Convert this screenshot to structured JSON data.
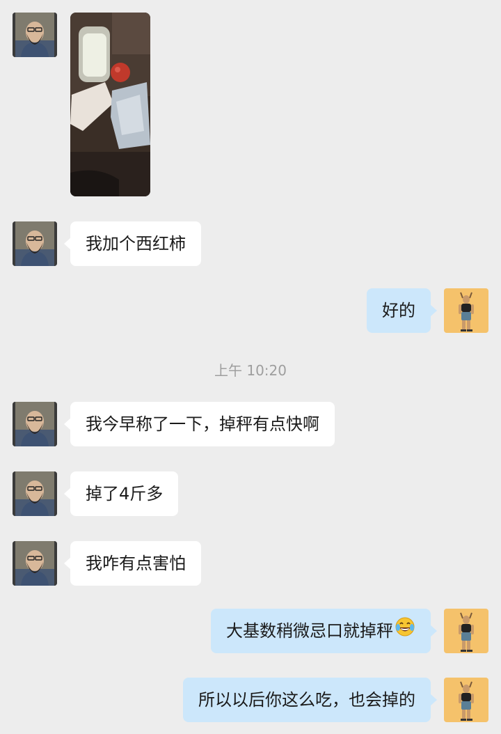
{
  "messages": [
    {
      "sender": "contact",
      "type": "image"
    },
    {
      "sender": "contact",
      "text": "我加个西红柿"
    },
    {
      "sender": "me",
      "text": "好的"
    },
    {
      "type": "timestamp",
      "text": "上午 10:20"
    },
    {
      "sender": "contact",
      "text": "我今早称了一下，掉秤有点快啊"
    },
    {
      "sender": "contact",
      "text": "掉了4斤多"
    },
    {
      "sender": "contact",
      "text": "我咋有点害怕"
    },
    {
      "sender": "me",
      "text": "大基数稍微忌口就掉秤",
      "emoji": "laughing-tears-emoji"
    },
    {
      "sender": "me",
      "text": "所以以后你这么吃，也会掉的"
    }
  ],
  "colors": {
    "background": "#ededed",
    "incoming_bubble": "#ffffff",
    "outgoing_bubble": "#cce7fb",
    "timestamp_text": "#9e9e9e"
  }
}
